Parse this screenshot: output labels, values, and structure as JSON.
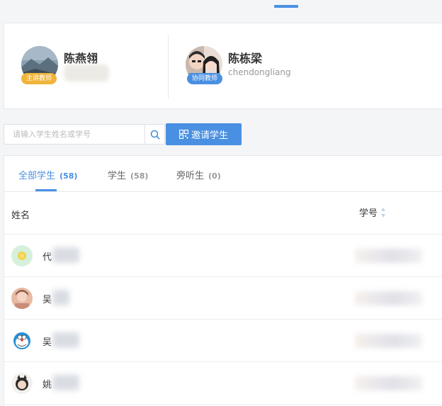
{
  "teachers": [
    {
      "name": "陈燕翎",
      "role": "主讲教师",
      "subtitle": ""
    },
    {
      "name": "陈栋梁",
      "role": "协同教师",
      "subtitle": "chendongliang"
    }
  ],
  "search": {
    "placeholder": "请输入学生姓名或学号"
  },
  "invite_button": {
    "label": "邀请学生"
  },
  "tabs": [
    {
      "label": "全部学生",
      "count": "(58)",
      "active": true
    },
    {
      "label": "学生",
      "count": "(58)",
      "active": false
    },
    {
      "label": "旁听生",
      "count": "(0)",
      "active": false
    }
  ],
  "table": {
    "columns": {
      "name": "姓名",
      "student_id": "学号"
    },
    "rows": [
      {
        "name": "代"
      },
      {
        "name": "吴"
      },
      {
        "name": "吴"
      },
      {
        "name": "姚"
      }
    ]
  },
  "colors": {
    "accent": "#4a90e2",
    "main_teacher_badge": "#f0b43a"
  }
}
